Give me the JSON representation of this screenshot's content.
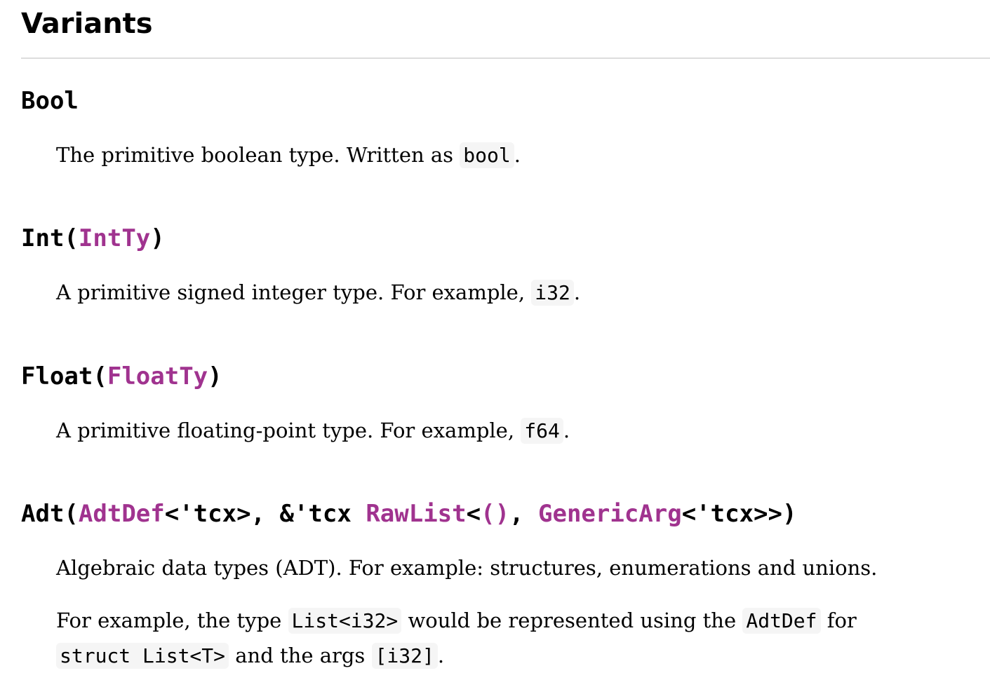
{
  "section": {
    "title": "Variants"
  },
  "variants": [
    {
      "name": "Bool",
      "description": {
        "before": "The primitive boolean type. Written as ",
        "code": "bool",
        "after": "."
      }
    },
    {
      "name": "Int",
      "open": "(",
      "arg_type": "IntTy",
      "close": ")",
      "description": {
        "before": "A primitive signed integer type. For example, ",
        "code": "i32",
        "after": "."
      }
    },
    {
      "name": "Float",
      "open": "(",
      "arg_type": "FloatTy",
      "close": ")",
      "description": {
        "before": "A primitive floating-point type. For example, ",
        "code": "f64",
        "after": "."
      }
    },
    {
      "name": "Adt",
      "open": "(",
      "signature_parts": {
        "adtdef": "AdtDef",
        "lt1": "<'tcx>, &'tcx ",
        "rawlist": "RawList",
        "lt2": "<",
        "unit": "()",
        "comma": ", ",
        "genericarg": "GenericArg",
        "lt3": "<'tcx>>)"
      },
      "description": "Algebraic data types (ADT). For example: structures, enumerations and unions.",
      "example": {
        "p1": "For example, the type ",
        "code1": "List<i32>",
        "p2": " would be represented using the ",
        "code2": "AdtDef",
        "p3": " for",
        "code3": "struct List<T>",
        "p4": " and the args ",
        "code4": "[i32]",
        "p5": "."
      }
    }
  ]
}
